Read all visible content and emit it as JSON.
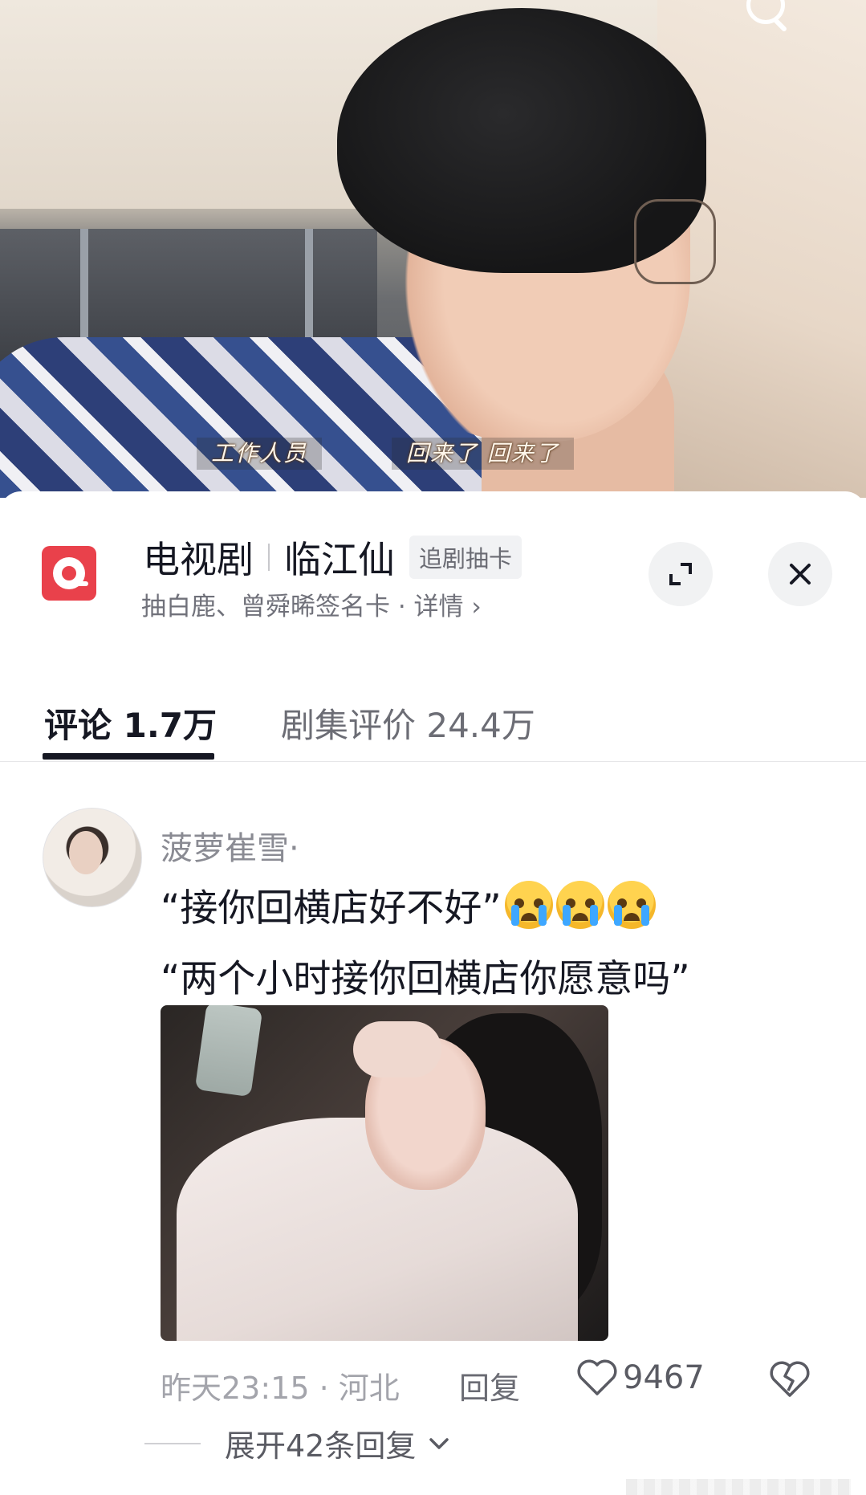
{
  "video": {
    "subtitle_speaker": "工作人员",
    "subtitle_line": "回来了 回来了"
  },
  "header": {
    "category": "电视剧",
    "show_title": "临江仙",
    "tag": "追剧抽卡",
    "subtitle": "抽白鹿、曾舜晞签名卡 · 详情",
    "subtitle_chevron": "›",
    "accent_color": "#e9414b"
  },
  "tabs": {
    "comments": "评论 1.7万",
    "reviews": "剧集评价 24.4万"
  },
  "comment": {
    "username": "菠萝崔雪·",
    "line1": "“接你回横店好不好”",
    "line2": "“两个小时接你回横店你愿意吗”",
    "time_location": "昨天23:15 · 河北",
    "reply_label": "回复",
    "like_count": "9467",
    "expand_label": "展开42条回复"
  },
  "icons": {
    "app": "tv-drama-icon",
    "expand": "expand-icon",
    "close": "close-icon",
    "like": "heart-icon",
    "dislike": "broken-heart-icon",
    "chevron": "chevron-down-icon",
    "search": "search-icon",
    "emoji": "loudly-crying-emoji"
  }
}
